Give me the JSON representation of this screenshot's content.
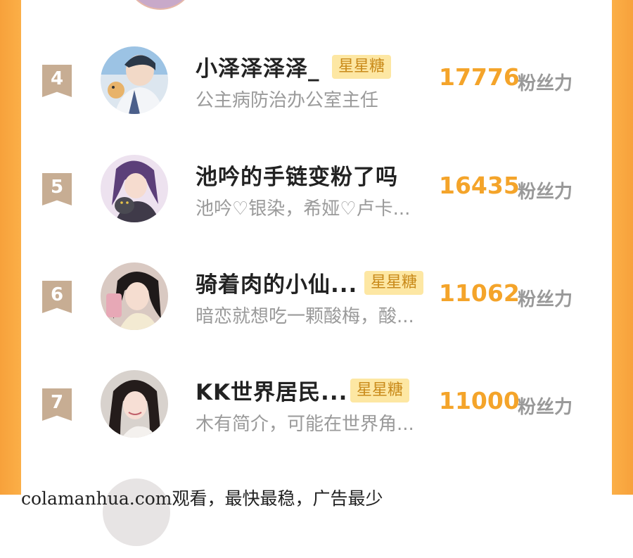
{
  "ranking": {
    "fan_unit": "粉丝力",
    "entries": [
      {
        "rank": "4",
        "name": "小泽泽泽泽_",
        "badge": "星星糖",
        "bio": "公主病防治办公室主任",
        "score": "17776"
      },
      {
        "rank": "5",
        "name": "池吟的手链变粉了吗",
        "badge": "",
        "bio": "池吟♡银染，希娅♡卢卡...",
        "score": "16435"
      },
      {
        "rank": "6",
        "name": "骑着肉的小仙...",
        "badge": "星星糖",
        "bio": "暗恋就想吃一颗酸梅，酸...",
        "score": "11062"
      },
      {
        "rank": "7",
        "name": "KK世界居民...",
        "badge": "星星糖",
        "bio": "木有简介，可能在世界角...",
        "score": "11000"
      }
    ]
  },
  "watermark": "colamanhua.com观看，最快最稳，广告最少",
  "colors": {
    "accent": "#f4a42a",
    "frame": "#fcb24a",
    "rank_badge": "#c7ad93",
    "tag_bg": "#fde7a3"
  }
}
